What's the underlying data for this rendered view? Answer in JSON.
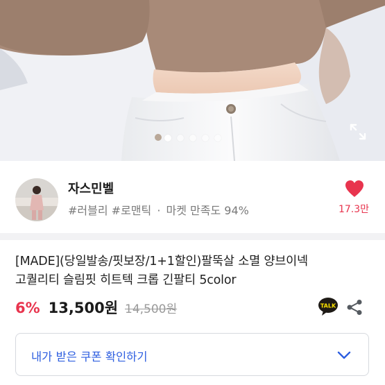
{
  "gallery": {
    "dot_count": 5,
    "active_dot": 0
  },
  "seller": {
    "name": "자스민벨",
    "tags": [
      "#러블리",
      "#로맨틱"
    ],
    "separator": "·",
    "satisfaction": "마켓 만족도 94%",
    "likes": "17.3만"
  },
  "product": {
    "title_line1": "[MADE](당일발송/핏보장/1+1할인)팔뚝살 소멸 양브이넥",
    "title_line2": "고퀄리티 슬림핏 히트텍 크롭 긴팔티 5color",
    "discount": "6%",
    "price": "13,500원",
    "original_price": "14,500원"
  },
  "coupon": {
    "label": "내가 받은 쿠폰 확인하기"
  },
  "colors": {
    "accent_red": "#e8344e",
    "link_blue": "#2d5ee0",
    "kakao_yellow": "#f9e000"
  },
  "icons": {
    "expand": "expand-icon",
    "heart": "heart-icon",
    "talk": "kakao-talk-icon",
    "share": "share-icon",
    "chevron": "chevron-down-icon"
  }
}
